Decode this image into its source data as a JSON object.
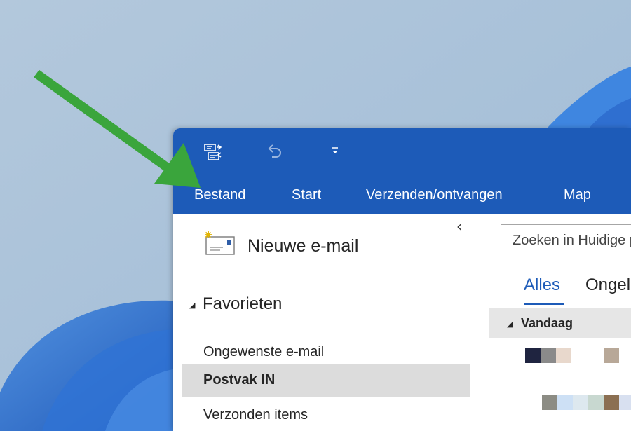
{
  "window": {
    "quick_access": {
      "send_receive_icon": "send-receive-all-icon",
      "undo_icon": "undo-icon",
      "customize_icon": "customize-quick-access-icon"
    },
    "menu_tabs": [
      "Bestand",
      "Start",
      "Verzenden/ontvangen",
      "Map"
    ]
  },
  "folder_pane": {
    "new_email_label": "Nieuwe e-mail",
    "favorites_label": "Favorieten",
    "folders": [
      {
        "label": "Ongewenste e-mail",
        "selected": false
      },
      {
        "label": "Postvak IN",
        "selected": true
      },
      {
        "label": "Verzonden items",
        "selected": false
      }
    ]
  },
  "mail_list": {
    "search_placeholder": "Zoeken in Huidige postvak",
    "filters": [
      "Alles",
      "Ongelezen"
    ],
    "active_filter": "Alles",
    "group_label": "Vandaag"
  },
  "colors": {
    "titlebar": "#1d5bb8",
    "accent": "#1d5bb8",
    "annotation_arrow": "#3aa53c",
    "selected_row": "#dcdcdc"
  }
}
